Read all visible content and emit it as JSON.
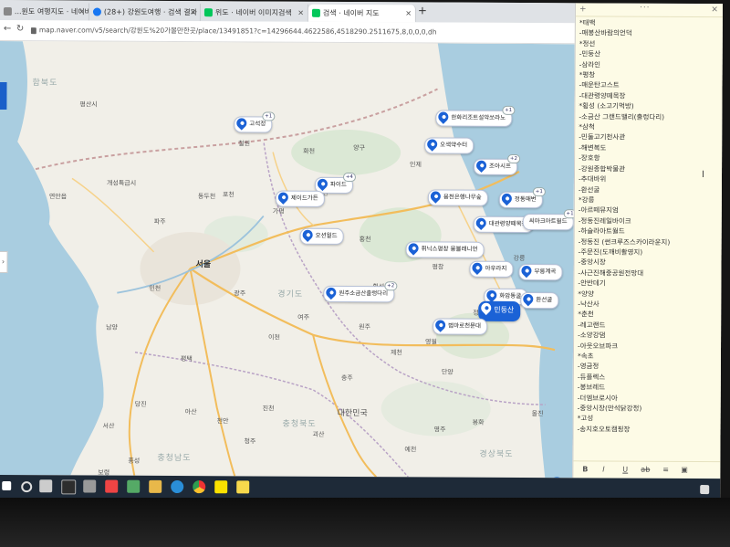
{
  "browser": {
    "tabs": [
      {
        "label": "...원도 여행지도 · 네이버 이미지",
        "favicon_color": "#888888"
      },
      {
        "label": "(28+) 강원도여행 · 검색 결과",
        "favicon_color": "#1877f2"
      },
      {
        "label": "위도 · 네이버 이미지검색",
        "favicon_color": "#03c75a"
      },
      {
        "label": "검색 · 네이버 지도",
        "favicon_color": "#03c75a"
      }
    ],
    "url": "map.naver.com/v5/search/강원도%20가볼만한곳/place/13491851?c=14296644.4622586,4518290.2511675,8,0,0,0,dh"
  },
  "map": {
    "labels": [
      {
        "text": "함북도",
        "kind": "region"
      },
      {
        "text": "평산시",
        "kind": "small"
      },
      {
        "text": "개성특급시",
        "kind": "small"
      },
      {
        "text": "연안읍",
        "kind": "small"
      },
      {
        "text": "철원",
        "kind": "small"
      },
      {
        "text": "화천",
        "kind": "small"
      },
      {
        "text": "양구",
        "kind": "small"
      },
      {
        "text": "인제",
        "kind": "small"
      },
      {
        "text": "동두천",
        "kind": "small"
      },
      {
        "text": "포천",
        "kind": "small"
      },
      {
        "text": "가평",
        "kind": "small"
      },
      {
        "text": "춘천",
        "kind": "small"
      },
      {
        "text": "파주",
        "kind": "small"
      },
      {
        "text": "서울",
        "kind": "big"
      },
      {
        "text": "인천",
        "kind": "small"
      },
      {
        "text": "남양",
        "kind": "small"
      },
      {
        "text": "광주",
        "kind": "small"
      },
      {
        "text": "경기도",
        "kind": "region"
      },
      {
        "text": "홍천",
        "kind": "small"
      },
      {
        "text": "횡성",
        "kind": "small"
      },
      {
        "text": "평창",
        "kind": "small"
      },
      {
        "text": "정선",
        "kind": "small"
      },
      {
        "text": "강릉",
        "kind": "small"
      },
      {
        "text": "원주",
        "kind": "small"
      },
      {
        "text": "영월",
        "kind": "small"
      },
      {
        "text": "평택",
        "kind": "small"
      },
      {
        "text": "이천",
        "kind": "small"
      },
      {
        "text": "여주",
        "kind": "small"
      },
      {
        "text": "충주",
        "kind": "small"
      },
      {
        "text": "제천",
        "kind": "small"
      },
      {
        "text": "단양",
        "kind": "small"
      },
      {
        "text": "대한민국",
        "kind": "big"
      },
      {
        "text": "충청북도",
        "kind": "region"
      },
      {
        "text": "충청남도",
        "kind": "region"
      },
      {
        "text": "경상북도",
        "kind": "region"
      },
      {
        "text": "당진",
        "kind": "small"
      },
      {
        "text": "아산",
        "kind": "small"
      },
      {
        "text": "천안",
        "kind": "small"
      },
      {
        "text": "서산",
        "kind": "small"
      },
      {
        "text": "진천",
        "kind": "small"
      },
      {
        "text": "괴산",
        "kind": "small"
      },
      {
        "text": "청주",
        "kind": "small"
      },
      {
        "text": "예천",
        "kind": "small"
      },
      {
        "text": "영주",
        "kind": "small"
      },
      {
        "text": "봉화",
        "kind": "small"
      },
      {
        "text": "울진",
        "kind": "small"
      },
      {
        "text": "홍성",
        "kind": "small"
      },
      {
        "text": "보령",
        "kind": "small"
      }
    ],
    "pins": [
      {
        "label": "고석정",
        "count": "+1",
        "selected": false
      },
      {
        "label": "한화리조트설악쏘라노",
        "count": "+1",
        "selected": false
      },
      {
        "label": "오색약수터",
        "count": "",
        "selected": false
      },
      {
        "label": "조아시프",
        "count": "+2",
        "selected": false
      },
      {
        "label": "파이드",
        "count": "+4",
        "selected": false
      },
      {
        "label": "제이드가든",
        "count": "",
        "selected": false
      },
      {
        "label": "용천은행나무숲",
        "count": "",
        "selected": false
      },
      {
        "label": "정동매번",
        "count": "+1",
        "selected": false
      },
      {
        "label": "오션월드",
        "count": "",
        "selected": false
      },
      {
        "label": "대관령양떼목장",
        "count": "",
        "selected": false
      },
      {
        "label": "씨마크아트월드",
        "count": "+1",
        "selected": false
      },
      {
        "label": "휘닉스평창 몽블래니언",
        "count": "",
        "selected": false
      },
      {
        "label": "아우라지",
        "count": "",
        "selected": false
      },
      {
        "label": "무릉계곡",
        "count": "",
        "selected": false
      },
      {
        "label": "원주소금산출렁다리",
        "count": "+2",
        "selected": false
      },
      {
        "label": "화암동굴",
        "count": "",
        "selected": false
      },
      {
        "label": "환선굴",
        "count": "",
        "selected": false
      },
      {
        "label": "민둥산",
        "count": "",
        "selected": true
      },
      {
        "label": "범마로천문대",
        "count": "",
        "selected": false
      }
    ]
  },
  "notepad": {
    "lines": [
      "*태백",
      "-매봉산바람의언덕",
      "*정선",
      "-민둥산",
      "-삼라인",
      "*평창",
      "-매운탄고스트",
      "-대관령양떼목장",
      "*횡성 (소고기먹방)",
      "-소금산 그랜드밸리(출렁다리)",
      "*삼척",
      "-민둘고기천사관",
      "-해변복도",
      "-장호항",
      "-강원종합박물관",
      "-추대바위",
      "-환선굴",
      "*강릉",
      "-아르떼뮤지엄",
      "-정동진레일바이크",
      "-하슬라아트월드",
      "-정동진 (썬크루즈스카이라운지)",
      "-주문진(도깨비촬영지)",
      "-중앙시장",
      "-사근진해중공원전망대",
      "-안반데기",
      "*양양",
      "-낙산사",
      "*춘천",
      "-레고랜드",
      "-소양강댐",
      "-아웃오브파크",
      "*속초",
      "-영금정",
      "-듀플렉스",
      "-봉브레드",
      "-더엠브로시아",
      "-중앙시장(만석닭강정)",
      "*고성",
      "-송지호오토캠핑장"
    ],
    "toolbar": [
      "B",
      "I",
      "U",
      "ab",
      "≡",
      "▣"
    ]
  },
  "taskbar": {
    "search_label": "",
    "icons": [
      "windows-start",
      "search",
      "task-view",
      "explorer",
      "store",
      "file-folder",
      "mail",
      "edge",
      "chrome",
      "kakaotalk",
      "sticky-notes"
    ]
  }
}
